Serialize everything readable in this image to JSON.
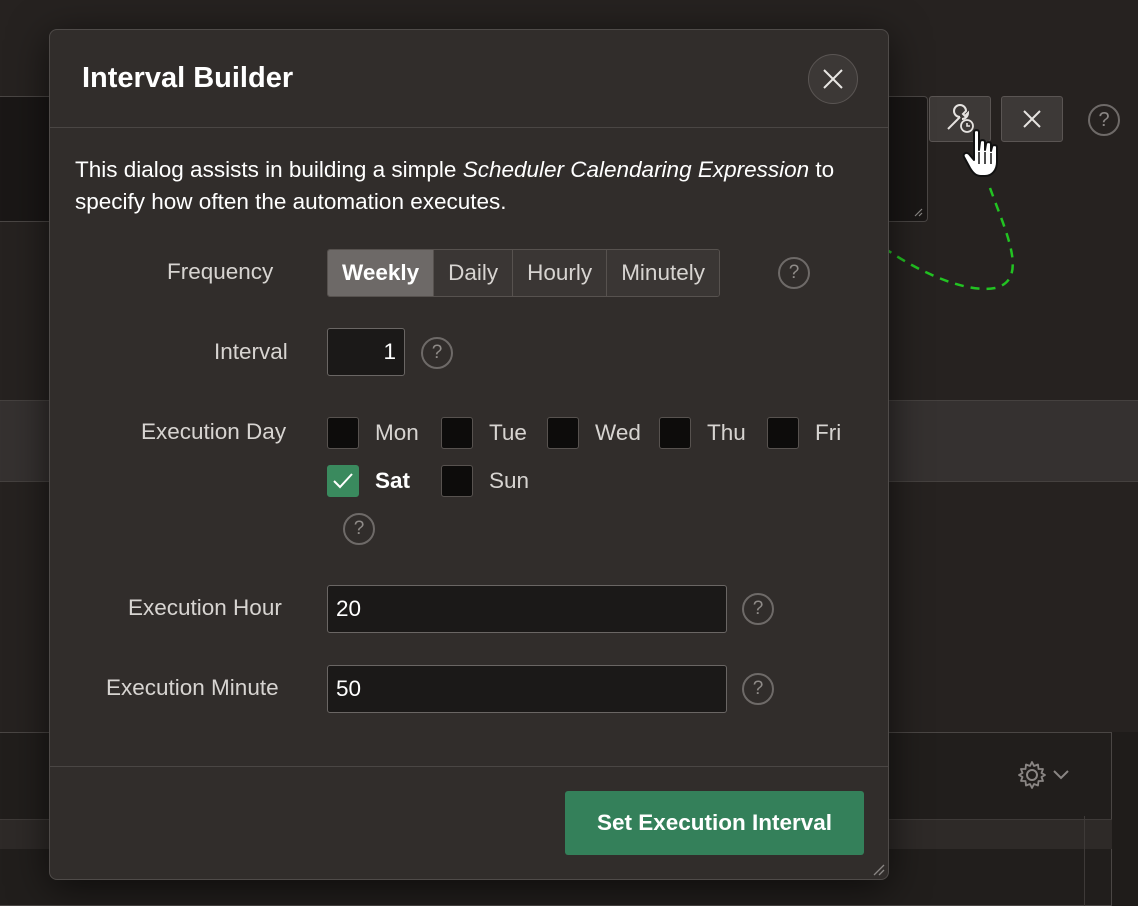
{
  "background": {
    "help_glyph": "?"
  },
  "dialog": {
    "title": "Interval Builder",
    "close_icon": "close-icon",
    "intro_before": "This dialog assists in building a simple ",
    "intro_emphasis": "Scheduler Calendaring Expression",
    "intro_after": " to specify how often the automation executes.",
    "frequency": {
      "label": "Frequency",
      "options": [
        "Weekly",
        "Daily",
        "Hourly",
        "Minutely"
      ],
      "selected": "Weekly"
    },
    "interval": {
      "label": "Interval",
      "value": "1"
    },
    "execution_day": {
      "label": "Execution Day",
      "days": [
        {
          "label": "Mon",
          "checked": false
        },
        {
          "label": "Tue",
          "checked": false
        },
        {
          "label": "Wed",
          "checked": false
        },
        {
          "label": "Thu",
          "checked": false
        },
        {
          "label": "Fri",
          "checked": false
        },
        {
          "label": "Sat",
          "checked": true
        },
        {
          "label": "Sun",
          "checked": false
        }
      ]
    },
    "execution_hour": {
      "label": "Execution Hour",
      "value": "20"
    },
    "execution_minute": {
      "label": "Execution Minute",
      "value": "50"
    },
    "help_glyph": "?",
    "submit_label": "Set Execution Interval"
  },
  "colors": {
    "accent": "#34805a",
    "annotation_arrow": "#22c322"
  }
}
